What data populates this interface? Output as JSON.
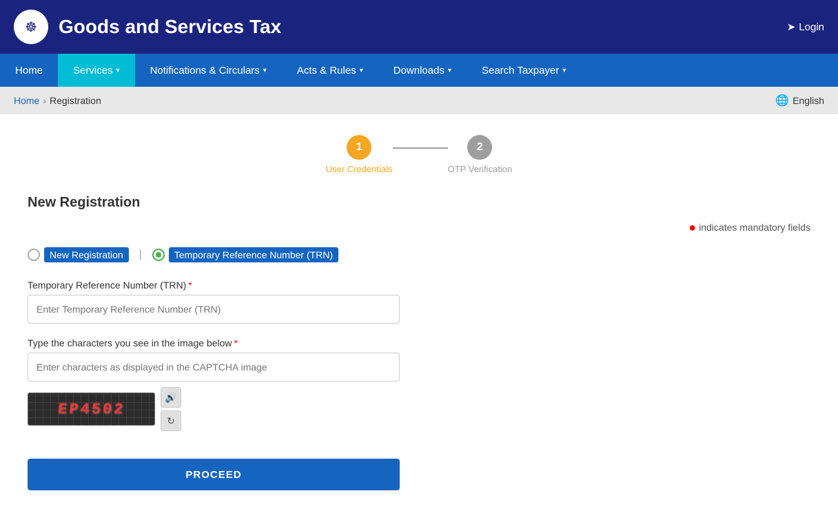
{
  "header": {
    "title": "Goods and Services Tax",
    "login_label": "Login",
    "emblem_symbol": "☸"
  },
  "navbar": {
    "items": [
      {
        "id": "home",
        "label": "Home",
        "has_arrow": false,
        "active": false
      },
      {
        "id": "services",
        "label": "Services",
        "has_arrow": true,
        "active": true
      },
      {
        "id": "notifications",
        "label": "Notifications & Circulars",
        "has_arrow": true,
        "active": false
      },
      {
        "id": "acts",
        "label": "Acts & Rules",
        "has_arrow": true,
        "active": false
      },
      {
        "id": "downloads",
        "label": "Downloads",
        "has_arrow": true,
        "active": false
      },
      {
        "id": "search-taxpayer",
        "label": "Search Taxpayer",
        "has_arrow": true,
        "active": false
      }
    ]
  },
  "breadcrumb": {
    "home": "Home",
    "separator": "›",
    "current": "Registration",
    "language": "English"
  },
  "steps": [
    {
      "id": "step1",
      "number": "1",
      "label": "User Credentials",
      "active": true
    },
    {
      "id": "step2",
      "number": "2",
      "label": "OTP Verification",
      "active": false
    }
  ],
  "form": {
    "title": "New Registration",
    "mandatory_note": "indicates mandatory fields",
    "radio_options": [
      {
        "id": "new-reg",
        "label": "New Registration",
        "selected": false
      },
      {
        "id": "trn",
        "label": "Temporary Reference Number (TRN)",
        "selected": true
      }
    ],
    "fields": [
      {
        "id": "trn-field",
        "label": "Temporary Reference Number (TRN)",
        "required": true,
        "placeholder": "Enter Temporary Reference Number (TRN)"
      },
      {
        "id": "captcha-field",
        "label": "Type the characters you see in the image below",
        "required": true,
        "placeholder": "Enter characters as displayed in the CAPTCHA image"
      }
    ],
    "captcha_text": "EP4502",
    "proceed_label": "PROCEED"
  }
}
